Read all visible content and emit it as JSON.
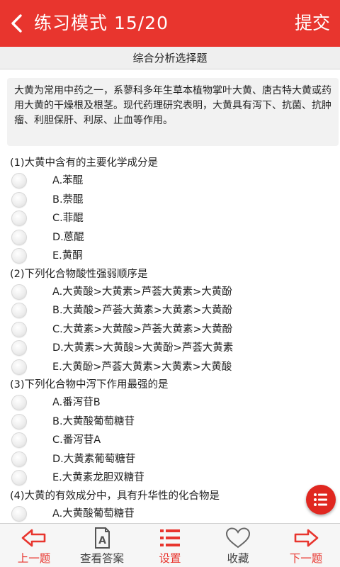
{
  "header": {
    "title": "练习模式  15/20",
    "submit_label": "提交"
  },
  "section_title": "综合分析选择题",
  "passage": "大黄为常用中药之一，系蓼科多年生草本植物掌叶大黄、唐古特大黄或药用大黄的干燥根及根茎。现代药理研究表明，大黄具有泻下、抗菌、抗肿瘤、利胆保肝、利尿、止血等作用。",
  "questions": [
    {
      "text": "(1)大黄中含有的主要化学成分是",
      "options": [
        "A.苯醌",
        "B.萘醌",
        "C.菲醌",
        "D.蒽醌",
        "E.黄酮"
      ]
    },
    {
      "text": "(2)下列化合物酸性强弱顺序是",
      "options": [
        "A.大黄酸>大黄素>芦荟大黄素>大黄酚",
        "B.大黄酸>芦荟大黄素>大黄素>大黄酚",
        "C.大黄素>大黄酸>芦荟大黄素>大黄酚",
        "D.大黄素>大黄酸>大黄酚>芦荟大黄素",
        "E.大黄酚>芦荟大黄素>大黄素>大黄酸"
      ]
    },
    {
      "text": "(3)下列化合物中泻下作用最强的是",
      "options": [
        "A.番泻苷B",
        "B.大黄酸葡萄糖苷",
        "C.番泻苷A",
        "D.大黄素葡萄糖苷",
        "E.大黄素龙胆双糖苷"
      ]
    },
    {
      "text": "(4)大黄的有效成分中，具有升华性的化合物是",
      "options": [
        "A.大黄酸葡萄糖苷"
      ]
    }
  ],
  "bottom_nav": {
    "prev": "上一题",
    "answer": "查看答案",
    "settings": "设置",
    "favorite": "收藏",
    "next": "下一题"
  },
  "colors": {
    "accent": "#e8352e",
    "fab": "#e02720",
    "section_bg": "#efefef",
    "passage_bg": "#f2f2f2"
  },
  "icons": {
    "back": "chevron-left-icon",
    "fab": "list-menu-icon",
    "prev": "arrow-left-icon",
    "answer": "document-a-icon",
    "settings": "list-icon",
    "favorite": "heart-icon",
    "next": "arrow-right-icon"
  }
}
